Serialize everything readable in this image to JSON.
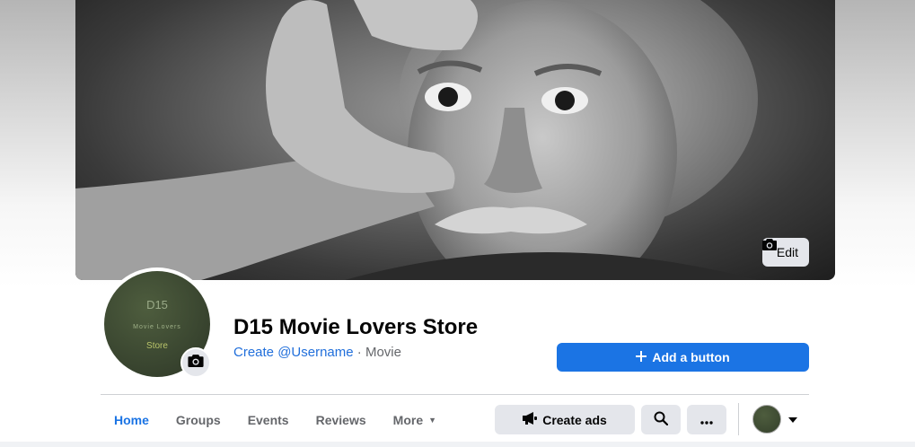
{
  "cover": {
    "edit_label": "Edit",
    "icon": "camera-icon"
  },
  "avatar": {
    "line1": "D15",
    "line2": "Movie Lovers",
    "line3": "Store",
    "badge_icon": "camera-icon"
  },
  "page": {
    "name": "D15 Movie Lovers Store",
    "username_link": "Create @Username",
    "separator": " · ",
    "category": "Movie"
  },
  "add_button": {
    "icon": "plus-icon",
    "label": "Add a button"
  },
  "tabs": [
    {
      "label": "Home",
      "active": true
    },
    {
      "label": "Groups",
      "active": false
    },
    {
      "label": "Events",
      "active": false
    },
    {
      "label": "Reviews",
      "active": false
    },
    {
      "label": "More",
      "active": false
    }
  ],
  "actions": {
    "create_ads": "Create ads",
    "create_ads_icon": "megaphone-icon",
    "search_icon": "search-icon",
    "more_icon": "ellipsis-icon",
    "switch_icon": "caret-down-icon"
  },
  "colors": {
    "primary": "#1b74e4",
    "secondary_button": "#e4e6eb",
    "text_secondary": "#65676b",
    "link": "#216fdb"
  }
}
